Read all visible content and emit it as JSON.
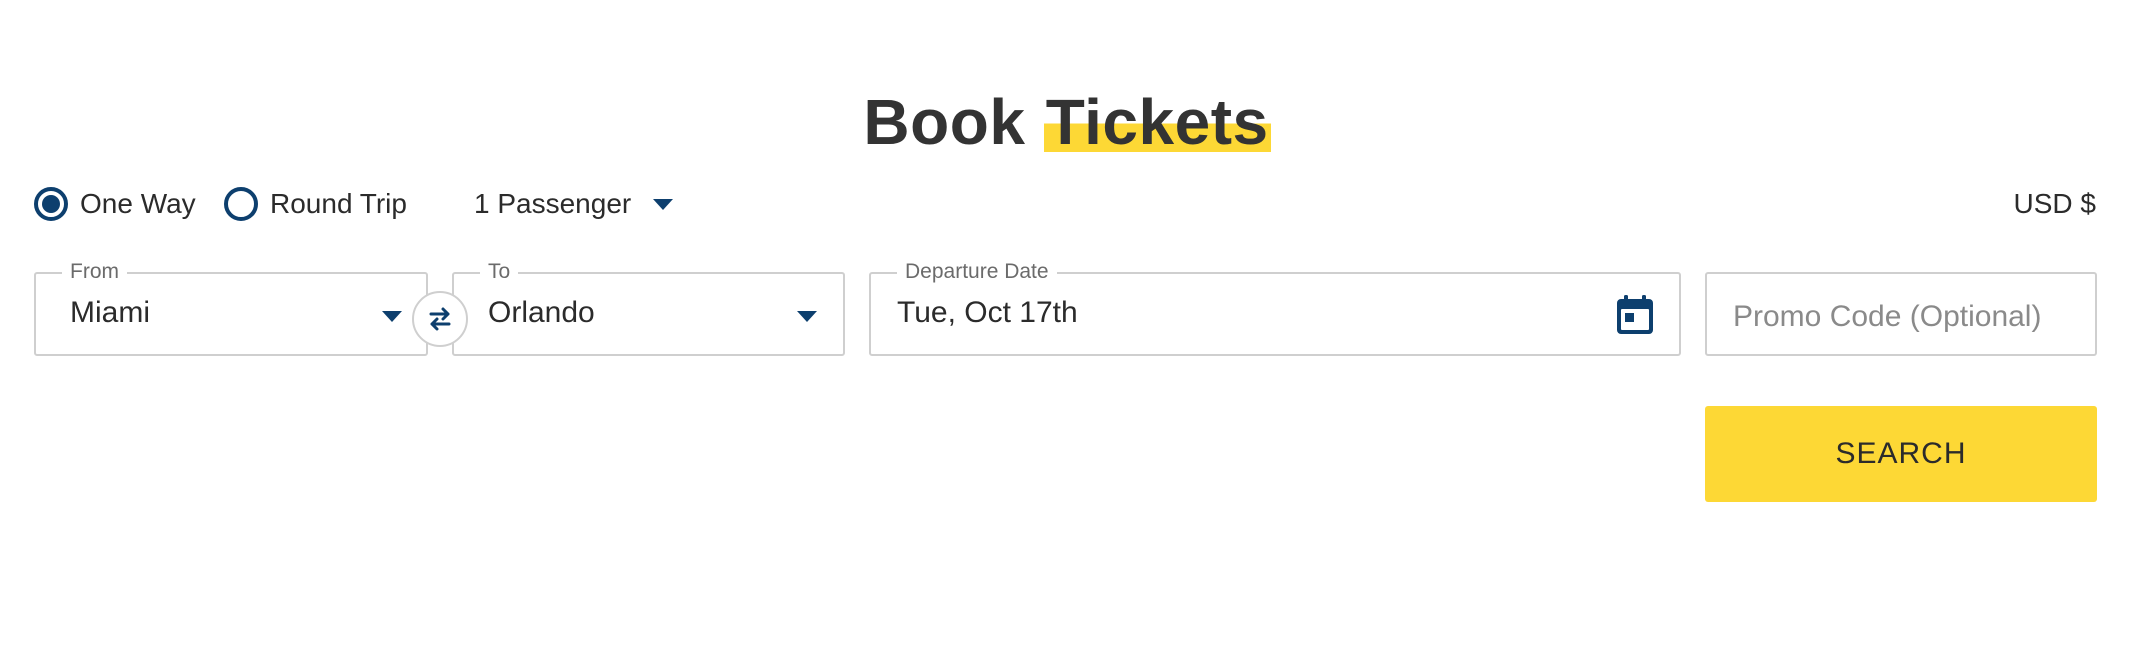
{
  "header": {
    "title_part1": "Book",
    "title_part2": "Tickets"
  },
  "trip_type": {
    "options": [
      {
        "label": "One Way",
        "selected": true
      },
      {
        "label": "Round Trip",
        "selected": false
      }
    ]
  },
  "passengers": {
    "label": "1 Passenger"
  },
  "currency": {
    "label": "USD $"
  },
  "search_form": {
    "from": {
      "label": "From",
      "value": "Miami"
    },
    "to": {
      "label": "To",
      "value": "Orlando"
    },
    "departure": {
      "label": "Departure Date",
      "value": "Tue, Oct 17th"
    },
    "promo": {
      "placeholder": "Promo Code (Optional)"
    },
    "search_label": "SEARCH"
  },
  "colors": {
    "accent": "#fdd835",
    "primary": "#0d3f6e",
    "border": "#cfcfcf",
    "text": "#333333"
  },
  "icons": [
    "chevron-down-icon",
    "swap-arrows-icon",
    "calendar-icon"
  ]
}
